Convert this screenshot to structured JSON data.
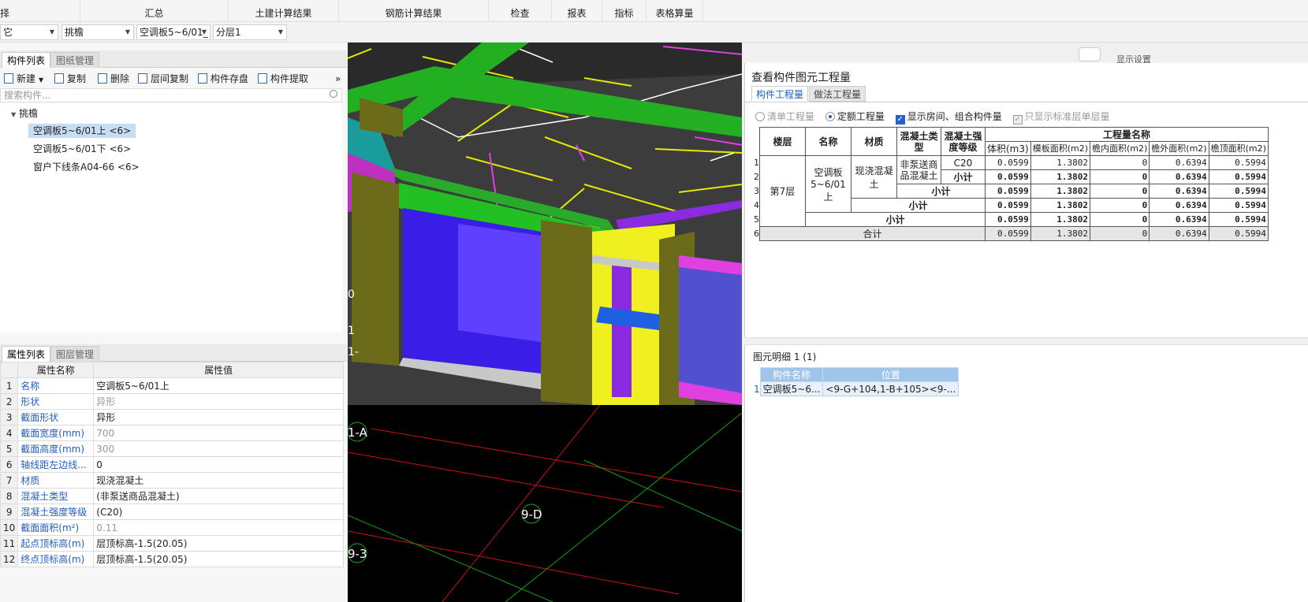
{
  "ribbon": {
    "tabs": [
      "择",
      "汇总",
      "土建计算结果",
      "钢筋计算结果",
      "检查",
      "报表",
      "指标",
      "表格算量"
    ]
  },
  "selectors": [
    {
      "value": "它"
    },
    {
      "value": "挑檐"
    },
    {
      "value": "空调板5~6/01_"
    },
    {
      "value": "分层1"
    }
  ],
  "component_panel": {
    "tabs": [
      "构件列表",
      "图纸管理"
    ],
    "toolbar": [
      "新建",
      "复制",
      "删除",
      "层间复制",
      "构件存盘",
      "构件提取"
    ],
    "more": "»",
    "search_placeholder": "搜索构件...",
    "tree": {
      "root": "挑檐",
      "items": [
        "空调板5~6/01上 <6>",
        "空调板5~6/01下 <6>",
        "窗户下线条A04-66 <6>"
      ],
      "selected_index": 0
    }
  },
  "property_panel": {
    "tabs": [
      "属性列表",
      "图层管理"
    ],
    "headers": [
      "属性名称",
      "属性值"
    ],
    "rows": [
      {
        "n": "1",
        "name": "名称",
        "value": "空调板5~6/01上",
        "gray": false
      },
      {
        "n": "2",
        "name": "形状",
        "value": "异形",
        "gray": true
      },
      {
        "n": "3",
        "name": "截面形状",
        "value": "异形",
        "gray": false
      },
      {
        "n": "4",
        "name": "截面宽度(mm)",
        "value": "700",
        "gray": true
      },
      {
        "n": "5",
        "name": "截面高度(mm)",
        "value": "300",
        "gray": true
      },
      {
        "n": "6",
        "name": "轴线距左边线...",
        "value": "0",
        "gray": false
      },
      {
        "n": "7",
        "name": "材质",
        "value": "现浇混凝土",
        "gray": false
      },
      {
        "n": "8",
        "name": "混凝土类型",
        "value": "(非泵送商品混凝土)",
        "gray": false
      },
      {
        "n": "9",
        "name": "混凝土强度等级",
        "value": "(C20)",
        "gray": false
      },
      {
        "n": "10",
        "name": "截面面积(m²)",
        "value": "0.11",
        "gray": true
      },
      {
        "n": "11",
        "name": "起点顶标高(m)",
        "value": "层顶标高-1.5(20.05)",
        "gray": false
      },
      {
        "n": "12",
        "name": "终点顶标高(m)",
        "value": "层顶标高-1.5(20.05)",
        "gray": false
      }
    ]
  },
  "viewport": {
    "axis_labels": [
      "0",
      "1",
      "1-",
      "1-A",
      "9-D",
      "9-3"
    ]
  },
  "right_header": {
    "text": "显示设置"
  },
  "quantity_dialog": {
    "title": "查看构件图元工程量",
    "tabs": [
      "构件工程量",
      "做法工程量"
    ],
    "options": [
      {
        "type": "radio",
        "label": "清单工程量",
        "checked": false,
        "disabled": true
      },
      {
        "type": "radio",
        "label": "定额工程量",
        "checked": true,
        "disabled": false
      },
      {
        "type": "check",
        "label": "显示房间、组合构件量",
        "checked": true,
        "disabled": false
      },
      {
        "type": "check",
        "label": "只显示标准层单层量",
        "checked": true,
        "disabled": true
      }
    ],
    "table": {
      "head": {
        "floor": "楼层",
        "name": "名称",
        "material": "材质",
        "concrete_type": "混凝土类型",
        "grade": "混凝土强度等级",
        "group": "工程量名称",
        "cols": [
          "体积(m3)",
          "模板面积(m2)",
          "檐内面积(m2)",
          "檐外面积(m2)",
          "檐顶面积(m2)"
        ]
      },
      "floor": "第7层",
      "name": "空调板5~6/01上",
      "material": "现浇混凝土",
      "concrete_type": "非泵送商品混凝土",
      "grade": "C20",
      "subtotal": "小计",
      "total": "合计",
      "row_numbers": [
        "1",
        "2",
        "3",
        "4",
        "5",
        "6"
      ],
      "rows": [
        [
          "0.0599",
          "1.3802",
          "0",
          "0.6394",
          "0.5994"
        ],
        [
          "0.0599",
          "1.3802",
          "0",
          "0.6394",
          "0.5994"
        ],
        [
          "0.0599",
          "1.3802",
          "0",
          "0.6394",
          "0.5994"
        ],
        [
          "0.0599",
          "1.3802",
          "0",
          "0.6394",
          "0.5994"
        ],
        [
          "0.0599",
          "1.3802",
          "0",
          "0.6394",
          "0.5994"
        ],
        [
          "0.0599",
          "1.3802",
          "0",
          "0.6394",
          "0.5994"
        ]
      ]
    },
    "detail": {
      "title": "图元明细",
      "count": "1 (1)",
      "headers": [
        "构件名称",
        "位置"
      ],
      "row": {
        "n": "1",
        "name": "空调板5~6...",
        "position": "<9-G+104,1-B+105><9-..."
      }
    }
  }
}
